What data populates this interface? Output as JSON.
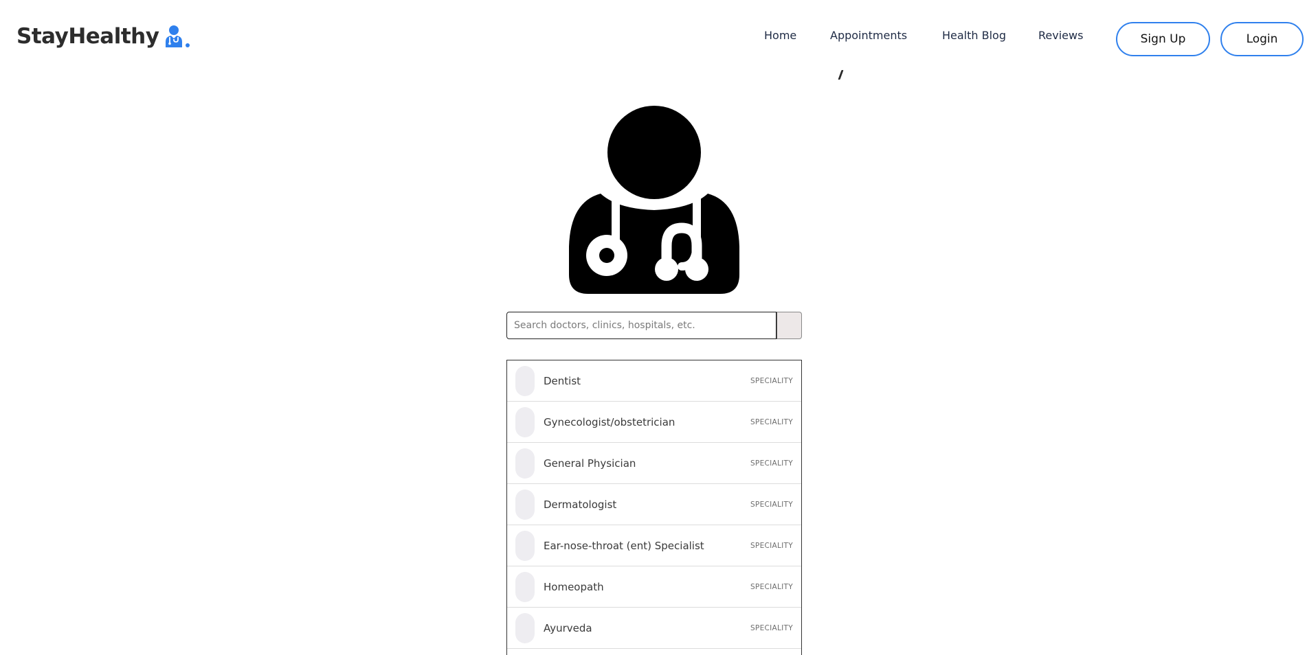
{
  "brand": {
    "name": "StayHealthy",
    "icon": "doctor-icon",
    "accent_color": "#2f80ed"
  },
  "nav": {
    "links": [
      "Home",
      "Appointments",
      "Health Blog",
      "Reviews"
    ],
    "signup_label": "Sign Up",
    "login_label": "Login"
  },
  "hero": {
    "icon": "doctor-stethoscope-icon"
  },
  "search": {
    "value": "",
    "placeholder": "Search doctors, clinics, hospitals, etc.",
    "button_icon": "search-icon"
  },
  "results": [
    {
      "name": "Dentist",
      "tag": "SPECIALITY"
    },
    {
      "name": "Gynecologist/obstetrician",
      "tag": "SPECIALITY"
    },
    {
      "name": "General Physician",
      "tag": "SPECIALITY"
    },
    {
      "name": "Dermatologist",
      "tag": "SPECIALITY"
    },
    {
      "name": "Ear-nose-throat (ent) Specialist",
      "tag": "SPECIALITY"
    },
    {
      "name": "Homeopath",
      "tag": "SPECIALITY"
    },
    {
      "name": "Ayurveda",
      "tag": "SPECIALITY"
    }
  ]
}
